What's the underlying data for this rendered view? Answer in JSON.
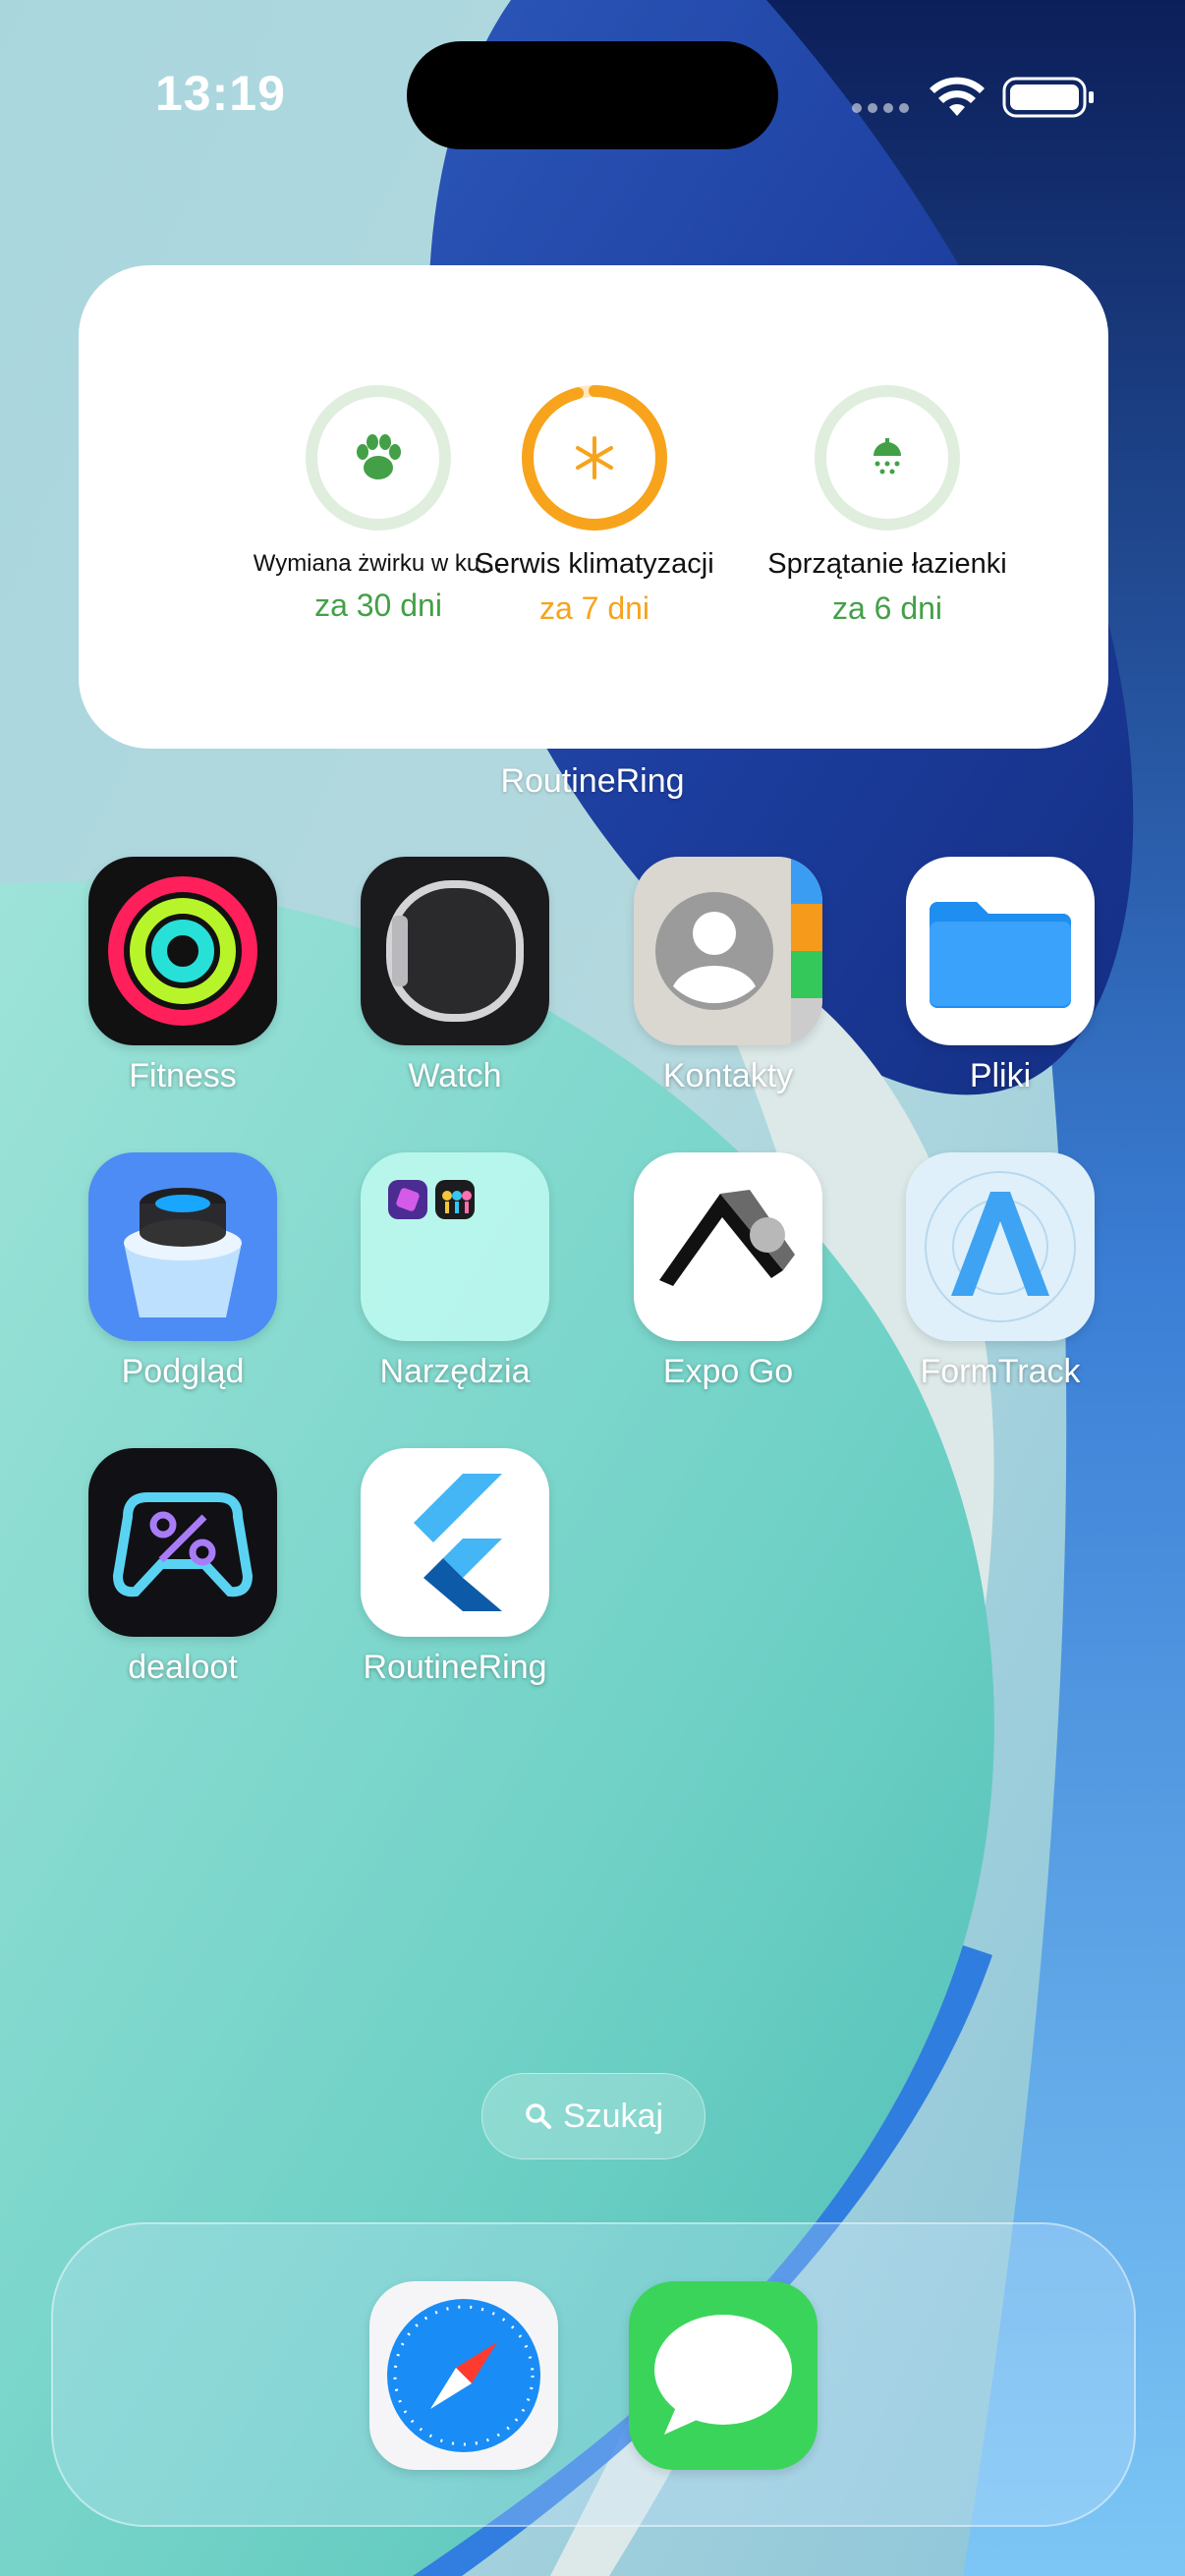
{
  "status_bar": {
    "time": "13:19"
  },
  "widget": {
    "name": "RoutineRing",
    "items": [
      {
        "title": "Wymiana żwirku w ku…",
        "due": "za 30 dni",
        "progress": 0.0,
        "icon": "paw-icon",
        "color": "#43a047"
      },
      {
        "title": "Serwis klimatyzacji",
        "due": "za 7 dni",
        "progress": 0.96,
        "icon": "snowflake-icon",
        "color": "#f7a31c"
      },
      {
        "title": "Sprzątanie łazienki",
        "due": "za 6 dni",
        "progress": 0.0,
        "icon": "shower-icon",
        "color": "#43a047"
      }
    ]
  },
  "apps": [
    {
      "label": "Fitness",
      "icon": "fitness-rings-icon"
    },
    {
      "label": "Watch",
      "icon": "watch-icon"
    },
    {
      "label": "Kontakty",
      "icon": "contacts-icon"
    },
    {
      "label": "Pliki",
      "icon": "folder-icon"
    },
    {
      "label": "Podgląd",
      "icon": "preview-loupe-icon"
    },
    {
      "label": "Narzędzia",
      "icon": "folder-group-icon"
    },
    {
      "label": "Expo Go",
      "icon": "expo-icon"
    },
    {
      "label": "FormTrack",
      "icon": "formtrack-icon"
    },
    {
      "label": "dealoot",
      "icon": "dealoot-icon"
    },
    {
      "label": "RoutineRing",
      "icon": "flutter-icon"
    }
  ],
  "search": {
    "label": "Szukaj"
  },
  "dock": [
    {
      "icon": "safari-icon"
    },
    {
      "icon": "messages-icon"
    }
  ]
}
